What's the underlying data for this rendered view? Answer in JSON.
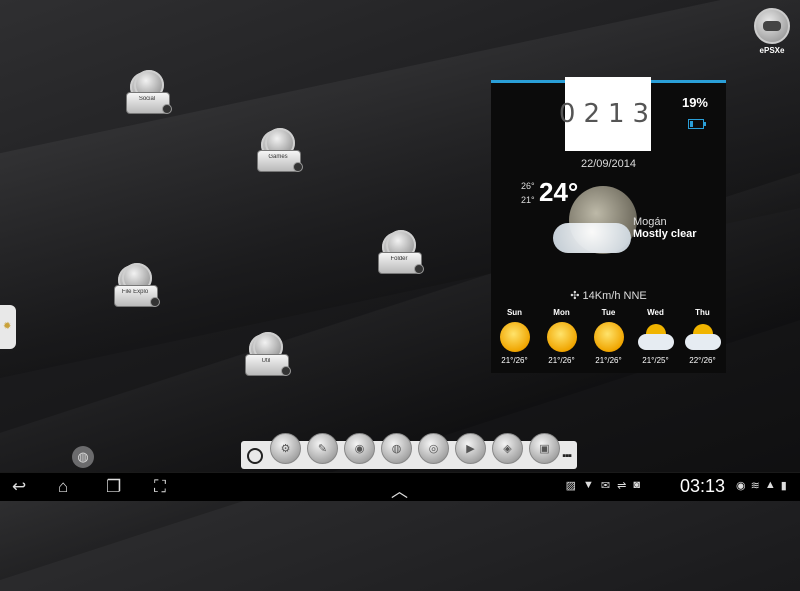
{
  "desktop": {
    "folders": [
      {
        "label": "Social"
      },
      {
        "label": "Games"
      },
      {
        "label": "Folder"
      },
      {
        "label": "File Explo"
      },
      {
        "label": "Util"
      }
    ],
    "shortcut_epsxe": {
      "label": "ePSXe"
    }
  },
  "widget": {
    "clock": "0213",
    "battery_pct": "19%",
    "date": "22/09/2014",
    "temp_high": "26°",
    "temp_low": "21°",
    "temp_now": "24°",
    "location": "Mogán",
    "condition": "Mostly clear",
    "wind": "14Km/h NNE",
    "forecast": [
      {
        "day": "Sun",
        "range": "21°/26°",
        "icon": "sunny-icon"
      },
      {
        "day": "Mon",
        "range": "21°/26°",
        "icon": "sunny-icon"
      },
      {
        "day": "Tue",
        "range": "21°/26°",
        "icon": "sunny-icon"
      },
      {
        "day": "Wed",
        "range": "21°/25°",
        "icon": "partly-cloudy-icon"
      },
      {
        "day": "Thu",
        "range": "22°/26°",
        "icon": "partly-cloudy-icon"
      }
    ]
  },
  "dock": {
    "icons": [
      "settings-icon",
      "text-app-icon",
      "camera-icon",
      "globe-app-icon",
      "chrome-icon",
      "play-store-icon",
      "maps-icon",
      "gallery-icon"
    ]
  },
  "statusbar": {
    "time": "03:13"
  },
  "colors": {
    "accent": "#2a9fd8",
    "background": "#1b1b1d"
  }
}
